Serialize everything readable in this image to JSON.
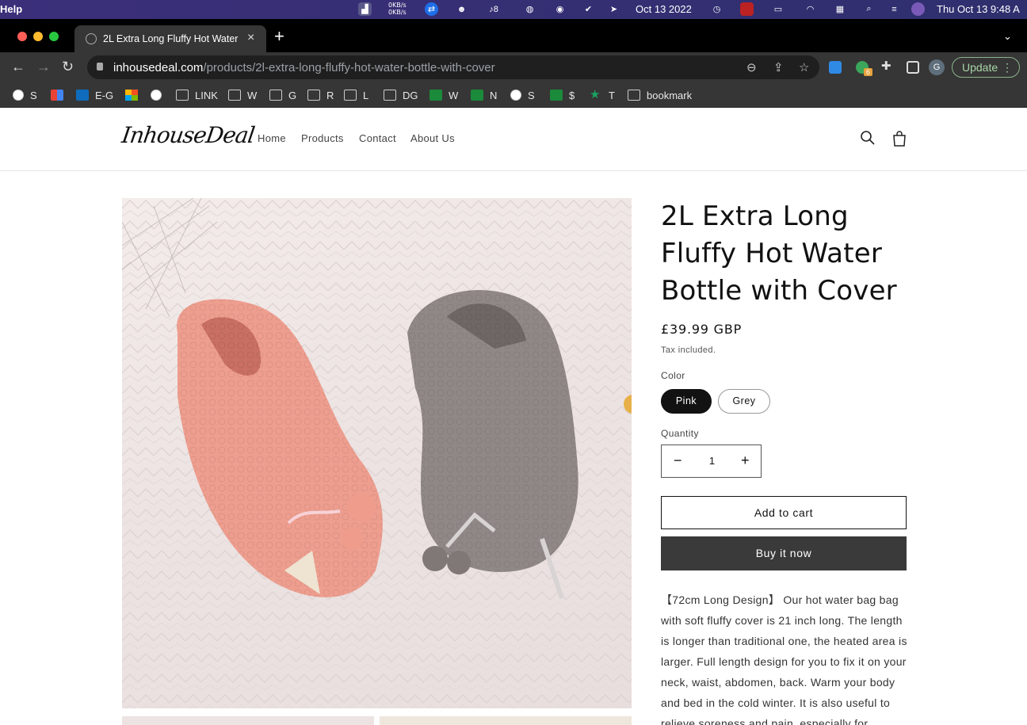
{
  "menubar": {
    "help": "Help",
    "net_up": "0KB/s",
    "net_down": "0KB/s",
    "notif_count": "8",
    "date": "Oct 13 2022",
    "clock": "Thu Oct 13  9:48 A"
  },
  "browser": {
    "tab_title": "2L Extra Long Fluffy Hot Water",
    "new_tab": "+",
    "url_domain": "inhousedeal.com",
    "url_path": "/products/2l-extra-long-fluffy-hot-water-bottle-with-cover",
    "avatar_initial": "G",
    "ext_badge": "6",
    "update_label": "Update"
  },
  "bookmarks": [
    {
      "label": "S",
      "icon": "globe"
    },
    {
      "label": "",
      "icon": "gmail"
    },
    {
      "label": "E-G",
      "icon": "outlook"
    },
    {
      "label": "",
      "icon": "microsoft"
    },
    {
      "label": "",
      "icon": "globe"
    },
    {
      "label": "LINK",
      "icon": "folder"
    },
    {
      "label": "W",
      "icon": "folder"
    },
    {
      "label": "G",
      "icon": "folder"
    },
    {
      "label": "R",
      "icon": "folder"
    },
    {
      "label": "L",
      "icon": "folder"
    },
    {
      "label": "DG",
      "icon": "folder"
    },
    {
      "label": "W",
      "icon": "green-sheet"
    },
    {
      "label": "N",
      "icon": "green-sheet"
    },
    {
      "label": "S",
      "icon": "globe"
    },
    {
      "label": "$",
      "icon": "green-sheet"
    },
    {
      "label": "T",
      "icon": "star"
    },
    {
      "label": "bookmark",
      "icon": "folder"
    }
  ],
  "site": {
    "logo": "InhouseDeal",
    "nav": [
      "Home",
      "Products",
      "Contact",
      "About Us"
    ]
  },
  "product": {
    "title": "2L Extra Long Fluffy Hot Water Bottle with Cover",
    "price": "£39.99 GBP",
    "tax_note": "Tax included.",
    "color_label": "Color",
    "colors": [
      "Pink",
      "Grey"
    ],
    "selected_color": "Pink",
    "quantity_label": "Quantity",
    "quantity": "1",
    "add_to_cart": "Add to cart",
    "buy_now": "Buy it now",
    "description": "【72cm Long Design】 Our hot water bag bag with soft fluffy cover is 21 inch long. The length is longer than traditional one, the heated area is larger. Full length design for you to fix it on your neck, waist, abdomen, back. Warm your body and bed in the cold winter. It is also useful to relieve soreness and pain, especially for"
  },
  "colors": {
    "menubar_bg": "#2f2f6e",
    "chrome_bg": "#363636",
    "button_dark": "#3a3a3a",
    "update_green": "#a8d5a8"
  }
}
